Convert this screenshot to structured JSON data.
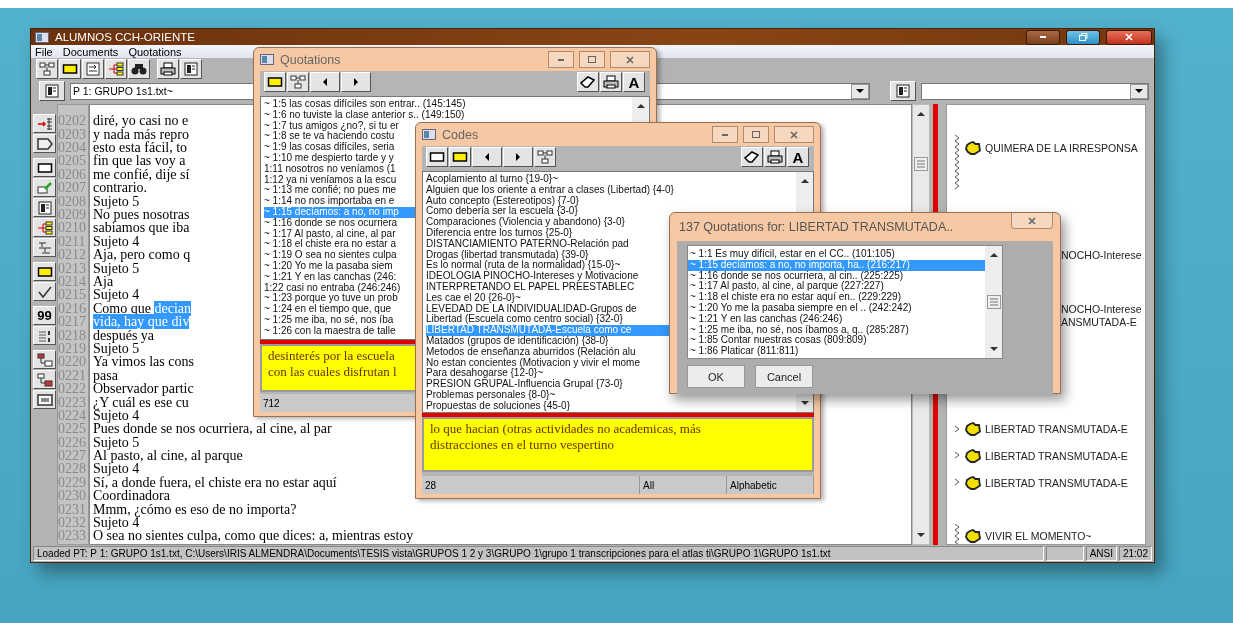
{
  "main_window": {
    "title": "ALUMNOS CCH-ORIENTE",
    "menu": [
      "File",
      "Documents",
      "Quotations"
    ],
    "quote_button": "99",
    "document_field": {
      "value": "P 1: GRUPO 1s1.txt~"
    },
    "lines": [
      {
        "number": "0202",
        "text": "diré, yo casi no e"
      },
      {
        "number": "0203",
        "text": "y nada más repro"
      },
      {
        "number": "0204",
        "text": "esto esta fácil, to",
        "margin_code": {
          "kind": "range",
          "label": "QUIMERA DE LA IRRESPONSA"
        }
      },
      {
        "number": "0205",
        "text": "fin que las voy a"
      },
      {
        "number": "0206",
        "text": "me confié, dije sí"
      },
      {
        "number": "0207",
        "text": "contrario."
      },
      {
        "number": "0208",
        "text": "Sujeto 5"
      },
      {
        "number": "0209",
        "text": "No pues nosotras"
      },
      {
        "number": "0210",
        "text": "sabiamos que iba"
      },
      {
        "number": "0211",
        "text": "Sujeto 4"
      },
      {
        "number": "0212",
        "text": "Aja, pero como q",
        "margin_code": {
          "kind": "covered",
          "label": "NOCHO-Interese"
        }
      },
      {
        "number": "0213",
        "text": "Sujeto 5"
      },
      {
        "number": "0214",
        "text": "Aja"
      },
      {
        "number": "0215",
        "text": "Sujeto 4"
      },
      {
        "number": "0216",
        "parts": [
          {
            "text": "Como que ",
            "selected": false
          },
          {
            "text": "decian",
            "selected": true
          }
        ],
        "margin_code": {
          "kind": "covered",
          "label": "NOCHO-Interese"
        }
      },
      {
        "number": "0217",
        "parts": [
          {
            "text": "vida, hay que div",
            "selected": true
          }
        ],
        "margin_code": {
          "kind": "covered",
          "label": "ANSMUTADA-E"
        }
      },
      {
        "number": "0218",
        "text": "después ya"
      },
      {
        "number": "0219",
        "text": "Sujeto 5"
      },
      {
        "number": "0220",
        "text": "Ya vimos las cons"
      },
      {
        "number": "0221",
        "text": "pasa"
      },
      {
        "number": "0222",
        "text": "Observador partic"
      },
      {
        "number": "0223",
        "text": "¿Y cuál es ese cu"
      },
      {
        "number": "0224",
        "text": "Sujeto 4"
      },
      {
        "number": "0225",
        "text": "Pues donde se nos ocurriera, al cine, al par",
        "margin_code": {
          "kind": "line",
          "label": "LIBERTAD TRANSMUTADA-E"
        }
      },
      {
        "number": "0226",
        "text": "Sujeto 5"
      },
      {
        "number": "0227",
        "text": "Al pasto, al cine, al parque",
        "margin_code": {
          "kind": "line",
          "label": "LIBERTAD TRANSMUTADA-E"
        }
      },
      {
        "number": "0228",
        "text": "Sujeto 4"
      },
      {
        "number": "0229",
        "text": "Sí, a donde fuera, el chiste era no estar aquí",
        "margin_code": {
          "kind": "line",
          "label": "LIBERTAD TRANSMUTADA-E"
        }
      },
      {
        "number": "0230",
        "text": "Coordinadora"
      },
      {
        "number": "0231",
        "text": "Mmm, ¿cómo es eso de no importa?"
      },
      {
        "number": "0232",
        "text": "Sujeto 4"
      },
      {
        "number": "0233",
        "text": "O sea no sientes culpa, como que dices: a, mientras estoy",
        "margin_code": {
          "kind": "range-end",
          "label": "VIVIR EL MOMENTO~"
        }
      }
    ],
    "status_bar": {
      "message": "Loaded PT: P 1: GRUPO 1s1.txt, C:\\Users\\IRIS ALMENDRA\\Documents\\TESIS vista\\GRUPOS 1 2 y 3\\GRUPO 1\\grupo 1 transcripciones para el atlas ti\\GRUPO 1\\GRUPO 1s1.txt",
      "encoding": "ANSI",
      "time": "21:02"
    }
  },
  "quotations_window": {
    "title": "Quotations",
    "font_button": "A",
    "items": [
      {
        "text": "~ 1:5 las cosas difíciles son entrar.. (145:145)",
        "selected": false
      },
      {
        "text": "~ 1:6 no tuviste la clase anterior s.. (149:150)",
        "selected": false
      },
      {
        "text": "~ 1:7 tus amigos ¿no?, si tu er",
        "selected": false
      },
      {
        "text": "~ 1:8 se te va haciendo costu",
        "selected": false
      },
      {
        "text": "~ 1:9 las cosas difíciles, seria",
        "selected": false
      },
      {
        "text": "~ 1:10 me despierto tarde y y",
        "selected": false
      },
      {
        "text": "1:11 nosotros no veníamos (1",
        "selected": false
      },
      {
        "text": "1:12 ya ni veníamos a la escu",
        "selected": false
      },
      {
        "text": "~ 1:13 me confié; no pues me",
        "selected": false
      },
      {
        "text": "~ 1:14 no nos importaba en e",
        "selected": false
      },
      {
        "text": "~ 1:15 decíamos: a no, no imp",
        "selected": true
      },
      {
        "text": "~ 1:16 donde se nos ocurriera",
        "selected": false
      },
      {
        "text": "~ 1:17 Al pasto, al cine, al par",
        "selected": false
      },
      {
        "text": "~ 1:18 el chiste era no estar a",
        "selected": false
      },
      {
        "text": "~ 1:19 O sea no sientes culpa",
        "selected": false
      },
      {
        "text": "~ 1:20 Yo me la pasaba siem",
        "selected": false
      },
      {
        "text": "~ 1:21 Y en las canchas (246:",
        "selected": false
      },
      {
        "text": "1:22 casi no entraba (246:246)",
        "selected": false
      },
      {
        "text": "~ 1:23 porque yo tuve un prob",
        "selected": false
      },
      {
        "text": "~ 1:24 en el tiempo que, que",
        "selected": false
      },
      {
        "text": "~ 1:25 me iba, no sé, nos íba",
        "selected": false
      },
      {
        "text": "~ 1:26 con la maestra de talle",
        "selected": false
      }
    ],
    "comment_lines": [
      "desinterés por la escuela",
      "con las cuales disfrutan l"
    ],
    "status": [
      "712"
    ]
  },
  "codes_window": {
    "title": "Codes",
    "font_button": "A",
    "items": [
      {
        "text": "Acoplamiento al turno {19-0}~",
        "selected": false
      },
      {
        "text": "Alguien que los oriente a entrar a clases (Libertad) {4-0}",
        "selected": false
      },
      {
        "text": "Auto concepto (Estereotipos) {7-0}",
        "selected": false
      },
      {
        "text": "Como debería ser la escuela {3-0}",
        "selected": false
      },
      {
        "text": "Comparaciones (Violencia y abandono) {3-0}",
        "selected": false
      },
      {
        "text": "Diferencia entre los turnos {25-0}",
        "selected": false
      },
      {
        "text": "DISTANCIAMIENTO PATERNO-Relación pad",
        "selected": false
      },
      {
        "text": "Drogas (libertad transmutada) {39-0}",
        "selected": false
      },
      {
        "text": "Es lo normal (ruta de la normalidad) {15-0}~",
        "selected": false
      },
      {
        "text": "IDEOLOGIA PINOCHO-Intereses y Motivacione",
        "selected": false
      },
      {
        "text": "INTERPRETANDO EL PAPEL PREESTABLEC",
        "selected": false
      },
      {
        "text": "Les cae el 20 {26-0}~",
        "selected": false
      },
      {
        "text": "LEVEDAD DE LA INDIVIDUALIDAD-Grupos de",
        "selected": false
      },
      {
        "text": "Libertad (Escuela como centro social) {32-0}",
        "selected": false
      },
      {
        "text": "LIBERTAD TRANSMUTADA-Escuela como ce",
        "selected": true
      },
      {
        "text": "Matados (grupos de identificación) {38-0}",
        "selected": false
      },
      {
        "text": "Metodos de enseñanza aburridos (Relación alu",
        "selected": false
      },
      {
        "text": "No estan concientes (Motivacion y vivir el mome",
        "selected": false
      },
      {
        "text": "Para desahogarse {12-0}~",
        "selected": false
      },
      {
        "text": "PRESION GRUPAL-Influencia Grupal {73-0}",
        "selected": false
      },
      {
        "text": "Problemas personales {8-0}~",
        "selected": false
      },
      {
        "text": "Propuestas de soluciones {45-0}",
        "selected": false
      }
    ],
    "comment_lines": [
      "lo que hacian (otras actividades no academicas, más",
      "distracciones en el turno vespertino"
    ],
    "status": [
      "28",
      "All",
      "Alphabetic"
    ]
  },
  "quotations_dialog": {
    "title": "137 Quotations for: LIBERTAD TRANSMUTADA..",
    "items": [
      {
        "text": "~ 1:1 Es muy difícil, estar en el CC.. (101:105)",
        "selected": false
      },
      {
        "text": "~ 1:15 decíamos: a no, no importa, ha.. (216:217)",
        "selected": true
      },
      {
        "text": "~ 1:16 donde se nos ocurriera, al cin.. (225:225)",
        "selected": false
      },
      {
        "text": "~ 1:17 Al pasto, al cine, al parque (227:227)",
        "selected": false
      },
      {
        "text": "~ 1:18 el chiste era no estar aquí en.. (229:229)",
        "selected": false
      },
      {
        "text": "~ 1:20 Yo me la pasaba siempre en el .. (242:242)",
        "selected": false
      },
      {
        "text": "~ 1:21 Y en las canchas (246:246)",
        "selected": false
      },
      {
        "text": "~ 1:25 me iba, no sé, nos íbamos a, q.. (285:287)",
        "selected": false
      },
      {
        "text": "~ 1:85 Contar nuestras cosas (809:809)",
        "selected": false
      },
      {
        "text": "~ 1:86 Platicar (811:811)",
        "selected": false
      }
    ],
    "buttons": [
      "OK",
      "Cancel"
    ]
  }
}
